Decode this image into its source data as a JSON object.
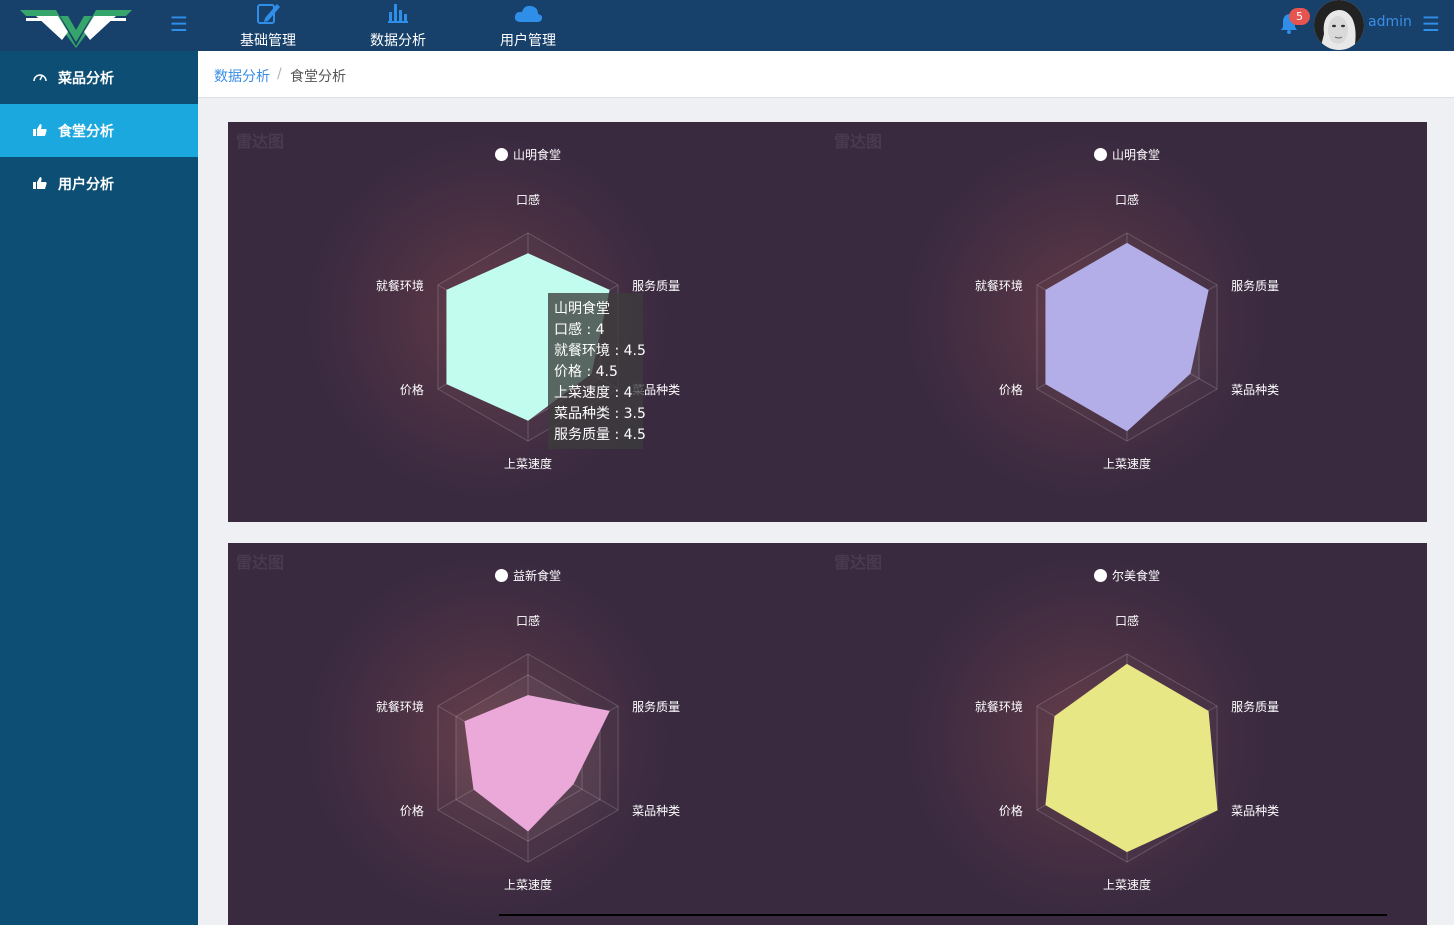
{
  "header": {
    "nav": [
      {
        "label": "基础管理",
        "icon": "edit-icon"
      },
      {
        "label": "数据分析",
        "icon": "bar-chart-icon"
      },
      {
        "label": "用户管理",
        "icon": "cloud-icon"
      }
    ],
    "notification_count": "5",
    "username": "admin"
  },
  "sidebar": {
    "items": [
      {
        "label": "菜品分析",
        "icon": "dashboard-icon"
      },
      {
        "label": "食堂分析",
        "icon": "thumbs-up-icon",
        "active": true
      },
      {
        "label": "用户分析",
        "icon": "thumbs-up-icon"
      }
    ]
  },
  "breadcrumb": {
    "parent": "数据分析",
    "separator": "/",
    "current": "食堂分析"
  },
  "tooltip": {
    "title": "山明食堂",
    "rows": [
      "口感 : 4",
      "就餐环境 : 4.5",
      "价格 : 4.5",
      "上菜速度 : 4",
      "菜品种类 : 3.5",
      "服务质量 : 4.5"
    ]
  },
  "chart_data": [
    {
      "type": "radar",
      "title": "雷达图",
      "series": [
        {
          "name": "山明食堂",
          "color": "#c1fcee",
          "values": [
            4,
            4.5,
            3.5,
            4,
            4.5,
            4.5
          ]
        }
      ],
      "indicators": [
        "口感",
        "服务质量",
        "菜品种类",
        "上菜速度",
        "价格",
        "就餐环境"
      ],
      "max": 5
    },
    {
      "type": "radar",
      "title": "雷达图",
      "series": [
        {
          "name": "山明食堂",
          "color": "#b3aee8",
          "values": [
            4.5,
            4.5,
            3.5,
            4.5,
            4.5,
            4.5
          ]
        }
      ],
      "indicators": [
        "口感",
        "服务质量",
        "菜品种类",
        "上菜速度",
        "价格",
        "就餐环境"
      ],
      "max": 5
    },
    {
      "type": "radar",
      "title": "雷达图",
      "series": [
        {
          "name": "益新食堂",
          "color": "#eaa9d9",
          "values": [
            3,
            4.5,
            2.5,
            3.5,
            3,
            3.5
          ]
        }
      ],
      "indicators": [
        "口感",
        "服务质量",
        "菜品种类",
        "上菜速度",
        "价格",
        "就餐环境"
      ],
      "max": 5
    },
    {
      "type": "radar",
      "title": "雷达图",
      "series": [
        {
          "name": "尔美食堂",
          "color": "#e8e786",
          "values": [
            4.5,
            4.5,
            5,
            4.5,
            4.5,
            4
          ]
        }
      ],
      "indicators": [
        "口感",
        "服务质量",
        "菜品种类",
        "上菜速度",
        "价格",
        "就餐环境"
      ],
      "max": 5
    }
  ]
}
